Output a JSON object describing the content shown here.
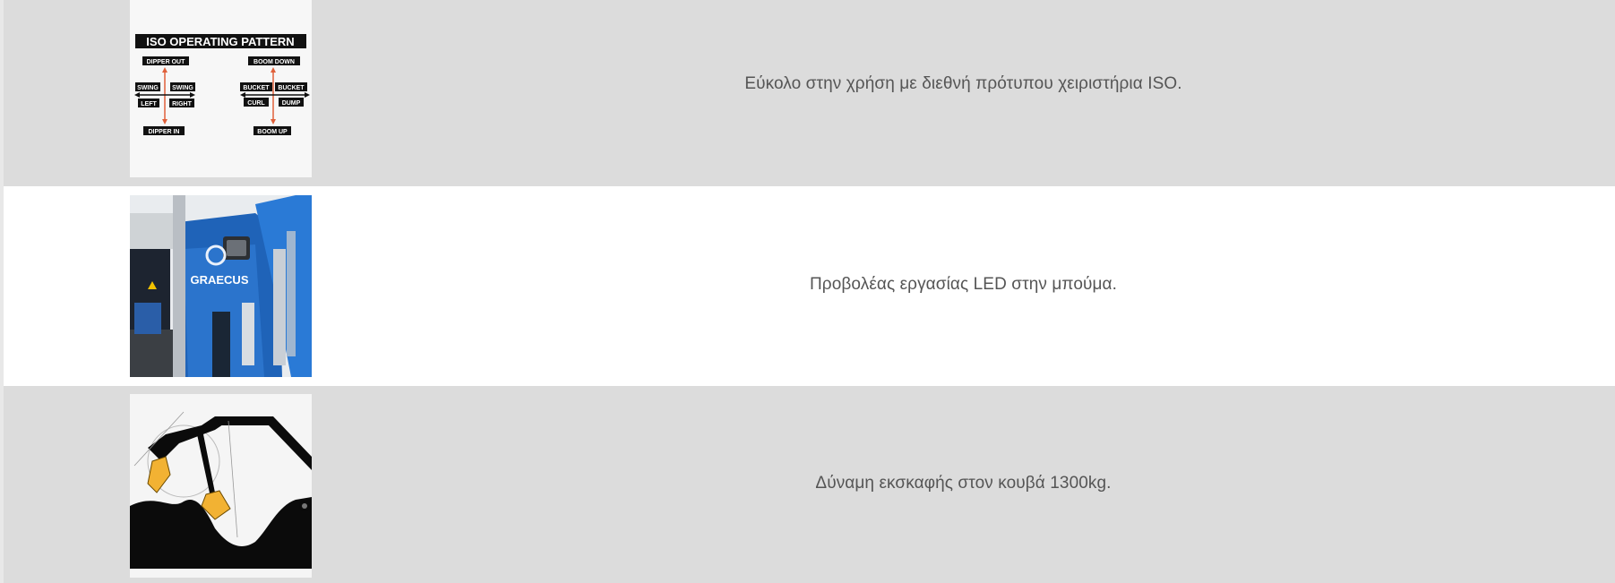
{
  "features": [
    {
      "caption": "Εύκολο στην χρήση με διεθνή πρότυπου χειριστήρια ISO.",
      "image": {
        "icon": "iso-operating-pattern-diagram",
        "title": "ISO OPERATING PATTERN",
        "labels": {
          "dipper_out": "DIPPER OUT",
          "dipper_in": "DIPPER IN",
          "swing_left_top": "SWING",
          "swing_left_bottom": "LEFT",
          "swing_right_top": "SWING",
          "swing_right_bottom": "RIGHT",
          "boom_down": "BOOM DOWN",
          "boom_up": "BOOM UP",
          "bucket_curl_top": "BUCKET",
          "bucket_curl_bottom": "CURL",
          "bucket_dump_top": "BUCKET",
          "bucket_dump_bottom": "DUMP"
        },
        "arrow_color": "#e0603a"
      }
    },
    {
      "caption": "Προβολέας εργασίας LED στην μπούμα.",
      "image": {
        "icon": "excavator-led-light-photo",
        "brand": "GRAECUS",
        "machine_color": "#1f63b8"
      }
    },
    {
      "caption": "Δύναμη εκσκαφής στον κουβά 1300kg.",
      "image": {
        "icon": "excavator-digging-diagram",
        "bucket_color": "#f2b233"
      }
    }
  ],
  "colors": {
    "row_gray": "#dcdcdc",
    "row_white": "#ffffff",
    "caption_text": "#555555"
  }
}
